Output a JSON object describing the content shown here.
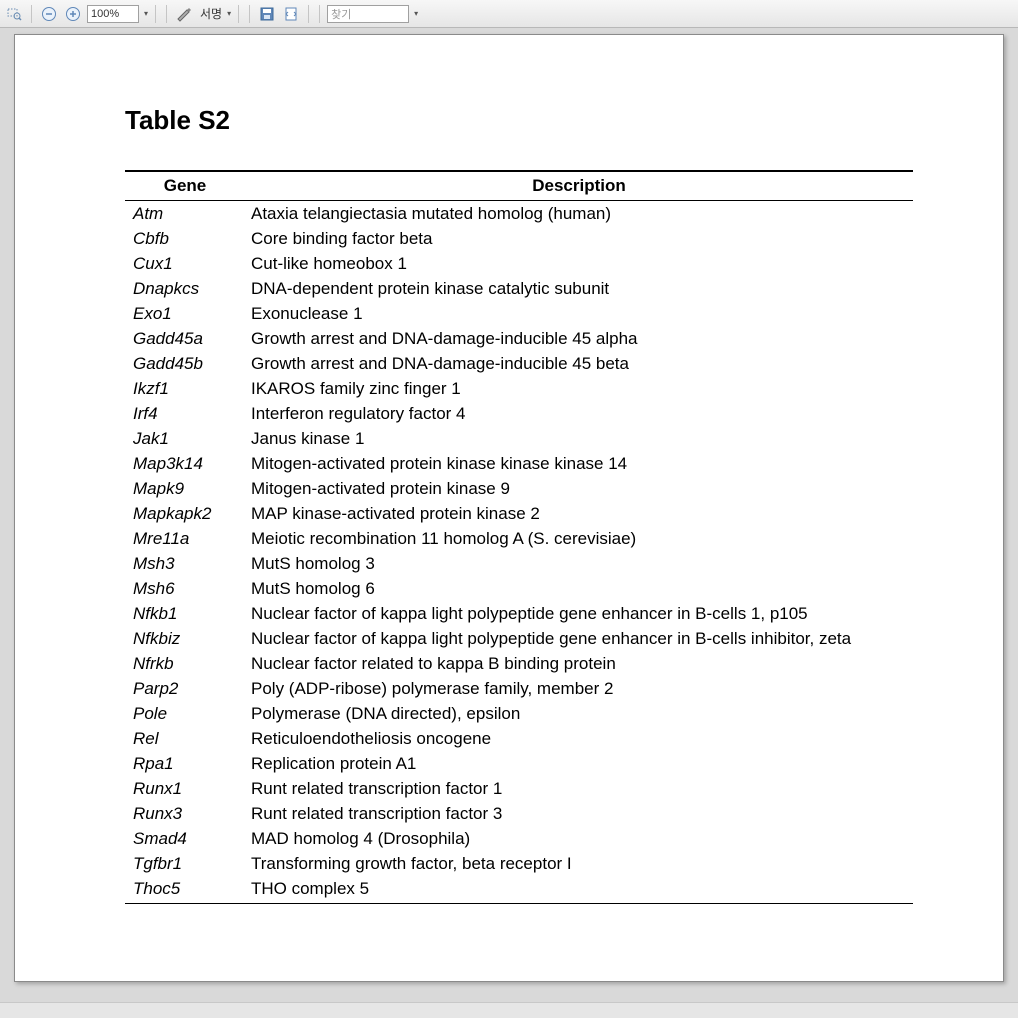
{
  "toolbar": {
    "zoom_value": "100%",
    "signature_label": "서명",
    "search_placeholder": "찾기"
  },
  "document": {
    "title": "Table S2",
    "headers": {
      "gene": "Gene",
      "description": "Description"
    },
    "rows": [
      {
        "gene": "Atm",
        "desc": "Ataxia telangiectasia mutated homolog (human)"
      },
      {
        "gene": "Cbfb",
        "desc": "Core binding factor beta"
      },
      {
        "gene": "Cux1",
        "desc": "Cut-like homeobox 1"
      },
      {
        "gene": "Dnapkcs",
        "desc": "DNA-dependent protein kinase catalytic subunit"
      },
      {
        "gene": "Exo1",
        "desc": "Exonuclease 1"
      },
      {
        "gene": "Gadd45a",
        "desc": "Growth arrest and DNA-damage-inducible 45 alpha"
      },
      {
        "gene": "Gadd45b",
        "desc": "Growth arrest and DNA-damage-inducible 45 beta"
      },
      {
        "gene": "Ikzf1",
        "desc": "IKAROS family zinc finger 1"
      },
      {
        "gene": "Irf4",
        "desc": "Interferon regulatory factor 4"
      },
      {
        "gene": "Jak1",
        "desc": "Janus kinase 1"
      },
      {
        "gene": "Map3k14",
        "desc": "Mitogen-activated protein kinase kinase kinase 14"
      },
      {
        "gene": "Mapk9",
        "desc": "Mitogen-activated protein kinase 9"
      },
      {
        "gene": "Mapkapk2",
        "desc": "MAP kinase-activated protein kinase 2"
      },
      {
        "gene": "Mre11a",
        "desc": "Meiotic recombination 11 homolog A (S. cerevisiae)"
      },
      {
        "gene": "Msh3",
        "desc": "MutS homolog 3"
      },
      {
        "gene": "Msh6",
        "desc": "MutS homolog 6"
      },
      {
        "gene": "Nfkb1",
        "desc": "Nuclear factor of kappa light polypeptide gene enhancer in B-cells 1, p105"
      },
      {
        "gene": "Nfkbiz",
        "desc": "Nuclear factor of kappa light polypeptide gene enhancer in B-cells inhibitor, zeta"
      },
      {
        "gene": "Nfrkb",
        "desc": "Nuclear factor related to kappa B binding protein"
      },
      {
        "gene": "Parp2",
        "desc": "Poly (ADP-ribose) polymerase family, member 2"
      },
      {
        "gene": "Pole",
        "desc": "Polymerase (DNA directed), epsilon"
      },
      {
        "gene": "Rel",
        "desc": "Reticuloendotheliosis oncogene"
      },
      {
        "gene": "Rpa1",
        "desc": "Replication protein A1"
      },
      {
        "gene": "Runx1",
        "desc": "Runt related transcription factor 1"
      },
      {
        "gene": "Runx3",
        "desc": "Runt related transcription factor 3"
      },
      {
        "gene": "Smad4",
        "desc": "MAD homolog 4 (Drosophila)"
      },
      {
        "gene": "Tgfbr1",
        "desc": "Transforming growth factor, beta receptor I"
      },
      {
        "gene": "Thoc5",
        "desc": "THO complex 5"
      }
    ]
  }
}
